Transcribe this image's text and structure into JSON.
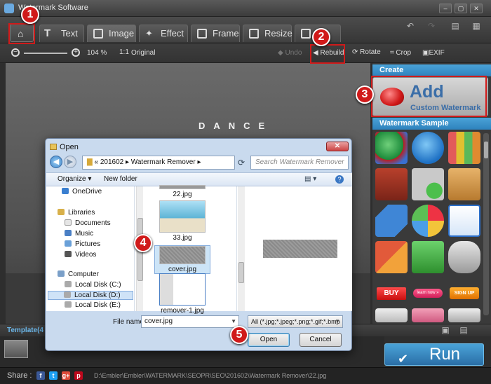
{
  "window": {
    "title": "Watermark Software",
    "buttons": [
      "–",
      "▢",
      "✕"
    ]
  },
  "tabs": [
    {
      "name": "home",
      "label": "",
      "icon": "home-icon"
    },
    {
      "name": "text",
      "label": "Text",
      "icon": "text-icon"
    },
    {
      "name": "image",
      "label": "Image",
      "icon": "image-icon"
    },
    {
      "name": "effect",
      "label": "Effect",
      "icon": "effect-icon"
    },
    {
      "name": "frame",
      "label": "Frame",
      "icon": "frame-icon"
    },
    {
      "name": "resize",
      "label": "Resize",
      "icon": "resize-icon"
    },
    {
      "name": "remove",
      "label": "Re",
      "icon": "remove-icon"
    }
  ],
  "toolbar": {
    "zoom_value": "104 %",
    "original_icon": "1:1",
    "original_label": "Original",
    "undo_label": "Undo",
    "rebuild_label": "Rebuild",
    "rotate_label": "Rotate",
    "crop_label": "Crop",
    "exif_label": "EXIF"
  },
  "canvas": {
    "overlay_text": "DANCE"
  },
  "panel": {
    "create_heading": "Create",
    "add_label": "Add",
    "add_sub": "Custom Watermark",
    "sample_heading": "Watermark Sample",
    "samples": [
      "pie-chart-3d",
      "pie-chart-blue",
      "price-tags",
      "books",
      "shopping-cart-plus",
      "box-package",
      "tag-blue",
      "pie-chart-colorful",
      "mail-envelope",
      "sale-tag",
      "shopping-basket",
      "database-arrow",
      "buy-button",
      "learn-now-button",
      "sign-up-button",
      "scissors",
      "sign-pink",
      "dollar-coin"
    ],
    "sample_labels": {
      "buy": "BUY",
      "learn": "learn now »",
      "signup": "SIGN UP"
    }
  },
  "template": {
    "label": "Template(4"
  },
  "run_button": {
    "label": "Run"
  },
  "status": {
    "share_label": "Share :",
    "social": [
      "f",
      "t",
      "g+",
      "p"
    ],
    "path": "D:\\Embler\\Embler\\WATERMARK\\SEOPR\\SEO\\201602\\Watermark Remover\\22.jpg"
  },
  "dialog": {
    "title": "Open",
    "address": [
      "«",
      "201602",
      "▸",
      "Watermark Remover",
      "▸"
    ],
    "search_placeholder": "Search Watermark Remover",
    "organize_label": "Organize ▾",
    "new_folder_label": "New folder",
    "tree": [
      "OneDrive",
      "Libraries",
      "Documents",
      "Music",
      "Pictures",
      "Videos",
      "Computer",
      "Local Disk (C:)",
      "Local Disk (D:)",
      "Local Disk (E:)"
    ],
    "files": [
      "22.jpg",
      "33.jpg",
      "cover.jpg",
      "remover-1.jpg"
    ],
    "filename_label": "File name:",
    "filename_value": "cover.jpg",
    "filter_value": "All (*.jpg;*.jpeg;*.png;*.gif;*.bmp",
    "open_label": "Open",
    "cancel_label": "Cancel"
  },
  "callouts": [
    "1",
    "2",
    "3",
    "4",
    "5"
  ],
  "colors": {
    "accent": "#2e82bd",
    "callout": "#d01a1a",
    "run": "#2a6ea6"
  }
}
